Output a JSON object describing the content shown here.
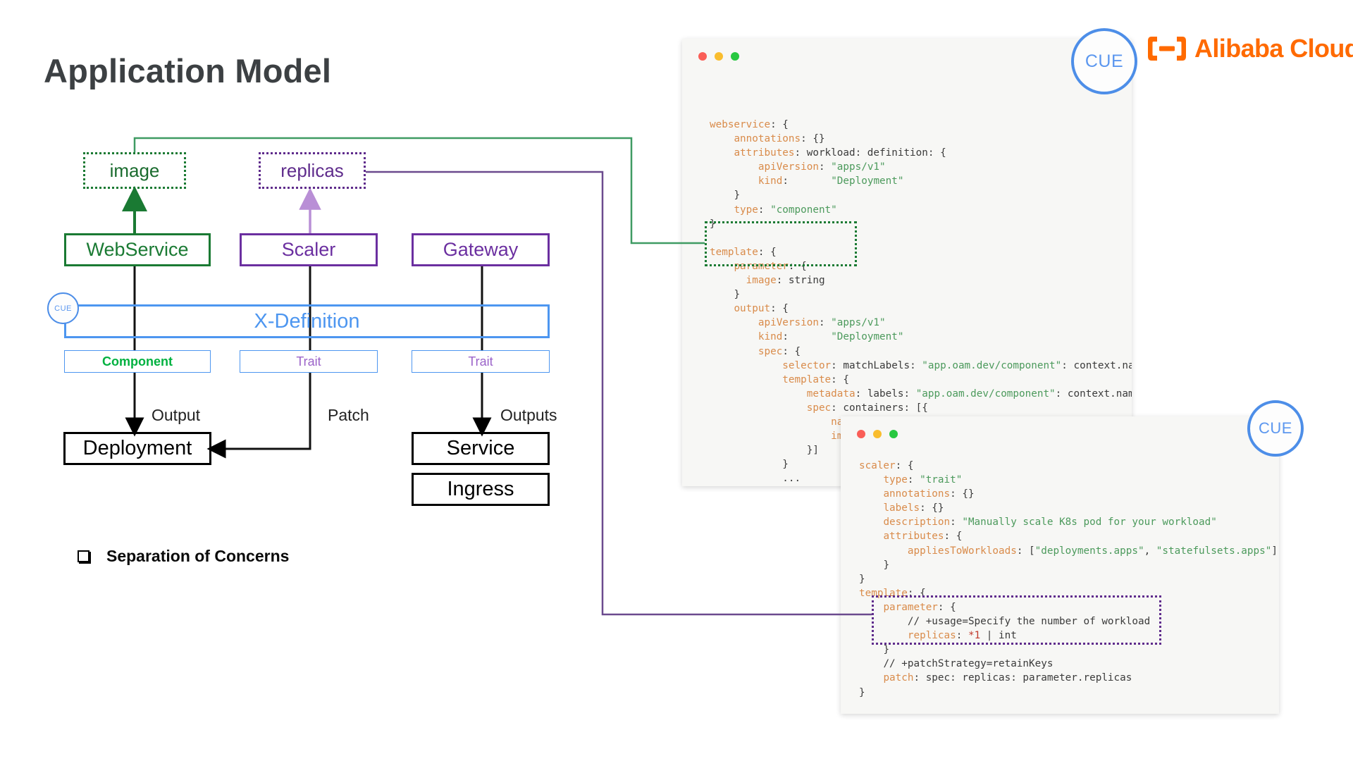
{
  "page_title": "Application Model",
  "bullet": {
    "marker": "checkbox-outline",
    "label": "Separation of Concerns"
  },
  "brand": {
    "wordmark": "Alibaba Cloud",
    "logo_color": "#ff6a00",
    "mark": "alibaba-cloud-mark"
  },
  "cue_badges": {
    "label": "CUE",
    "color": "#4d8ee8"
  },
  "diagram": {
    "parameter_boxes": [
      {
        "label": "image",
        "color": "#1a6b2e"
      },
      {
        "label": "replicas",
        "color": "#5f2c8c"
      }
    ],
    "definition_boxes": [
      {
        "label": "WebService",
        "color": "#1a7a33"
      },
      {
        "label": "Scaler",
        "color": "#6b2fa0"
      },
      {
        "label": "Gateway",
        "color": "#6b2fa0"
      }
    ],
    "xdefinition": {
      "label": "X-Definition",
      "color": "#4d96f0"
    },
    "kind_boxes": [
      {
        "label": "Component",
        "color": "#00b140"
      },
      {
        "label": "Trait",
        "color": "#9b63c9"
      },
      {
        "label": "Trait",
        "color": "#9b63c9"
      }
    ],
    "resource_boxes": [
      {
        "label": "Deployment"
      },
      {
        "label": "Service"
      },
      {
        "label": "Ingress"
      }
    ],
    "edge_labels": [
      {
        "label": "Output"
      },
      {
        "label": "Patch"
      },
      {
        "label": "Outputs"
      }
    ]
  },
  "code_panels": [
    {
      "name": "webservice-definition",
      "window_dots": [
        "red",
        "yellow",
        "green"
      ],
      "highlight": {
        "name": "image-parameter",
        "color": "#1a7a33"
      },
      "lines": [
        "webservice: {",
        "    annotations: {}",
        "    attributes: workload: definition: {",
        "        apiVersion: \"apps/v1\"",
        "        kind:       \"Deployment\"",
        "    }",
        "    type: \"component\"",
        "}",
        "",
        "template: {",
        "    parameter: {",
        "      image: string",
        "    }",
        "    output: {",
        "        apiVersion: \"apps/v1\"",
        "        kind:       \"Deployment\"",
        "        spec: {",
        "            selector: matchLabels: \"app.oam.dev/component\": context.name",
        "            template: {",
        "                metadata: labels: \"app.oam.dev/component\": context.name",
        "                spec: containers: [{",
        "                    name:  context.name",
        "                    image: parameter.image",
        "                }]",
        "            }",
        "            ...",
        "        }",
        "    }",
        "}"
      ]
    },
    {
      "name": "scaler-trait-definition",
      "window_dots": [
        "red",
        "yellow",
        "green"
      ],
      "highlight": {
        "name": "replicas-parameter",
        "color": "#5f2c8c"
      },
      "lines": [
        "scaler: {",
        "    type: \"trait\"",
        "    annotations: {}",
        "    labels: {}",
        "    description: \"Manually scale K8s pod for your workload\"",
        "    attributes: {",
        "        appliesToWorkloads: [\"deployments.apps\", \"statefulsets.apps\"]",
        "    }",
        "}",
        "template: {",
        "    parameter: {",
        "        // +usage=Specify the number of workload",
        "        replicas: *1 | int",
        "    }",
        "    // +patchStrategy=retainKeys",
        "    patch: spec: replicas: parameter.replicas",
        "}"
      ]
    }
  ]
}
